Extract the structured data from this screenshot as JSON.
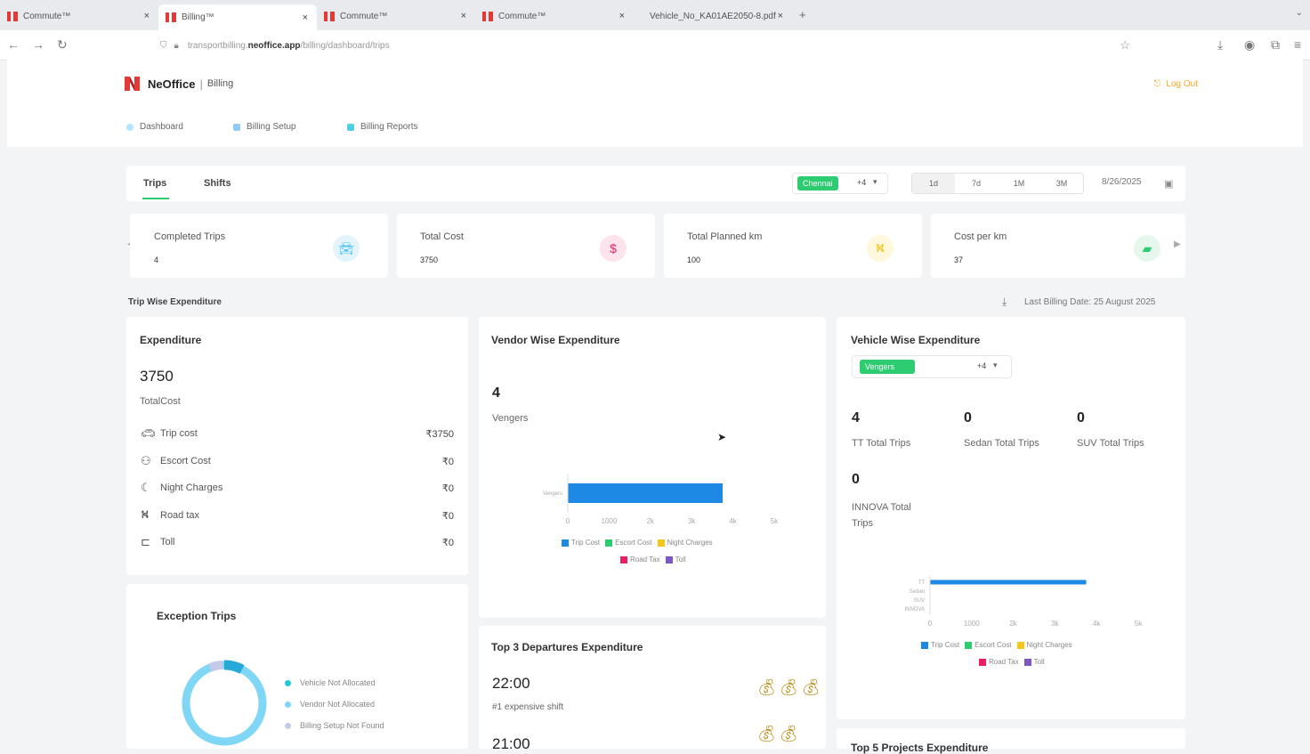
{
  "browser": {
    "tabs": [
      {
        "title": "Commute™",
        "close": "×"
      },
      {
        "title": "Billing™",
        "close": "×"
      },
      {
        "title": "Commute™",
        "close": "×"
      },
      {
        "title": "Commute™",
        "close": "×"
      },
      {
        "title": "Vehicle_No_KA01AE2050-8.pdf",
        "close": "×"
      }
    ],
    "new_tab": "+",
    "url_prefix": "transportbilling.",
    "url_domain": "neoffice.app",
    "url_path": "/billing/dashboard/trips"
  },
  "header": {
    "brand": "NeOffice",
    "separator": "|",
    "module": "Billing",
    "logout": "Log Out"
  },
  "menu": {
    "dashboard": "Dashboard",
    "billing_setup": "Billing Setup",
    "billing_reports": "Billing Reports"
  },
  "tabs": {
    "trips": "Trips",
    "shifts": "Shifts"
  },
  "filters": {
    "office": "Chennai",
    "office_count": "+4",
    "ranges": [
      "1d",
      "7d",
      "1M",
      "3M"
    ],
    "date": "8/26/2025"
  },
  "kpis": [
    {
      "title": "Completed Trips",
      "value": "4",
      "color": "#4fc3f7"
    },
    {
      "title": "Total Cost",
      "value": "3750",
      "color": "#e91e63"
    },
    {
      "title": "Total Planned km",
      "value": "100",
      "color": "#f5c518"
    },
    {
      "title": "Cost per km",
      "value": "37",
      "color": "#2ecc71"
    }
  ],
  "trip_wise": {
    "title": "Trip Wise Expenditure",
    "last_billing": "Last Billing Date: 25 August 2025"
  },
  "expenditure": {
    "title": "Expenditure",
    "total": "3750",
    "total_label": "TotalCost",
    "rows": [
      {
        "label": "Trip cost",
        "amount": "₹3750"
      },
      {
        "label": "Escort Cost",
        "amount": "₹0"
      },
      {
        "label": "Night Charges",
        "amount": "₹0"
      },
      {
        "label": "Road tax",
        "amount": "₹0"
      },
      {
        "label": "Toll",
        "amount": "₹0"
      }
    ]
  },
  "vendor": {
    "title": "Vendor Wise Expenditure",
    "count": "4",
    "name": "Vengers"
  },
  "vehicle": {
    "title": "Vehicle Wise Expenditure",
    "filter": "Vengers",
    "filter_count": "+4",
    "stats": [
      {
        "value": "4",
        "label": "TT Total Trips"
      },
      {
        "value": "0",
        "label": "Sedan Total Trips"
      },
      {
        "value": "0",
        "label": "SUV Total Trips"
      },
      {
        "value": "0",
        "label": "INNOVA Total Trips"
      }
    ]
  },
  "legend": [
    "Trip Cost",
    "Escort Cost",
    "Night Charges",
    "Road Tax",
    "Toll"
  ],
  "legend_colors": [
    "#1e88e5",
    "#2ecc71",
    "#f5c518",
    "#e91e63",
    "#7e57c2"
  ],
  "chart_data": [
    {
      "type": "bar",
      "orientation": "horizontal",
      "categories": [
        "Vengers"
      ],
      "series": [
        {
          "name": "Trip Cost",
          "values": [
            3750
          ]
        }
      ],
      "x_ticks": [
        "0",
        "1000",
        "2k",
        "3k",
        "4k",
        "5k"
      ],
      "xlim": [
        0,
        5000
      ]
    },
    {
      "type": "bar",
      "orientation": "horizontal",
      "categories": [
        "TT",
        "Sedan",
        "SUV",
        "INNOVA"
      ],
      "series": [
        {
          "name": "Trip Cost",
          "values": [
            3750,
            0,
            0,
            0
          ]
        }
      ],
      "x_ticks": [
        "0",
        "1000",
        "2k",
        "3k",
        "4k",
        "5k"
      ],
      "xlim": [
        0,
        5000
      ]
    }
  ],
  "exception": {
    "title": "Exception Trips",
    "legend": [
      {
        "label": "Vehicle Not Allocated",
        "color": "#26c6da"
      },
      {
        "label": "Vendor Not Allocated",
        "color": "#81d4fa"
      },
      {
        "label": "Billing Setup Not Found",
        "color": "#c5cae9"
      }
    ]
  },
  "departures": {
    "title": "Top 3 Departures Expenditure",
    "items": [
      {
        "time": "22:00",
        "sub": "#1 expensive shift"
      },
      {
        "time": "21:00",
        "sub": ""
      }
    ]
  },
  "projects": {
    "title": "Top 5 Projects Expenditure"
  }
}
